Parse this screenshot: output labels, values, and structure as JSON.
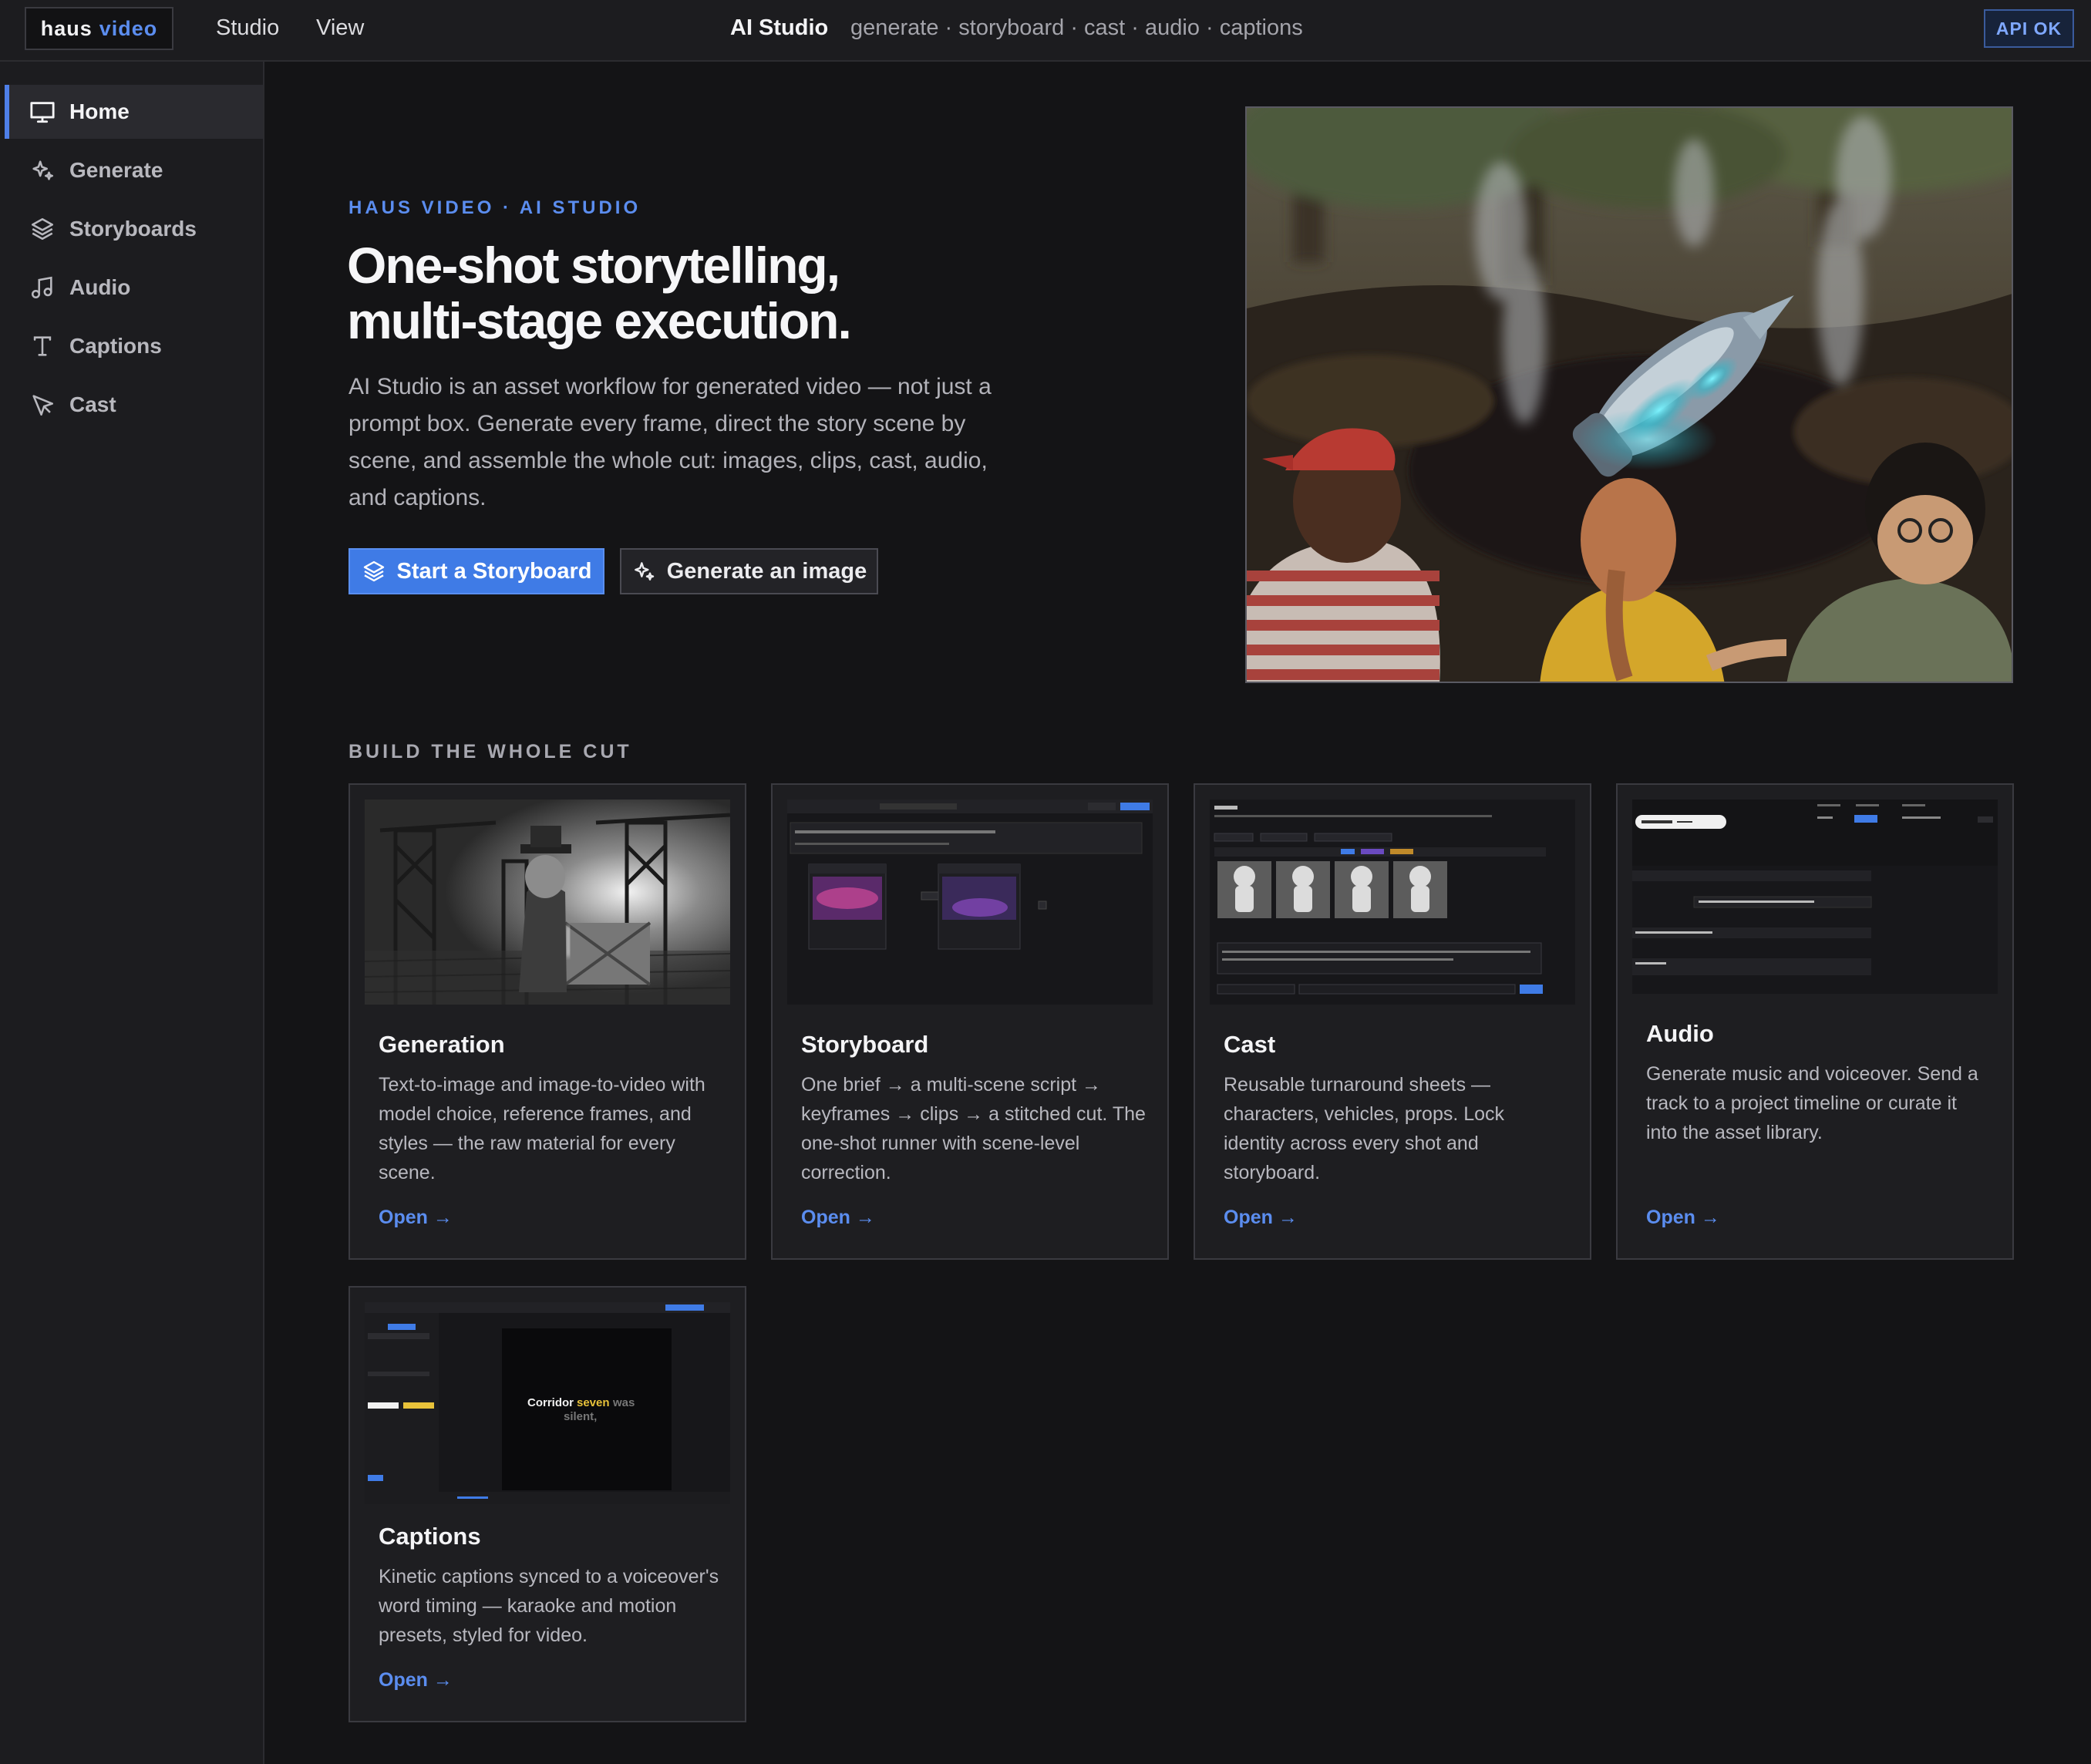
{
  "brand": {
    "name_part1": "haus",
    "name_part2": "video"
  },
  "topbar": {
    "menu": [
      "Studio",
      "View"
    ],
    "title": "AI Studio",
    "subtitle": "generate · storyboard · cast · audio · captions",
    "status_badge": "API OK"
  },
  "sidebar": {
    "items": [
      {
        "label": "Home",
        "icon": "monitor-icon",
        "active": true
      },
      {
        "label": "Generate",
        "icon": "sparkles-icon"
      },
      {
        "label": "Storyboards",
        "icon": "layers-icon"
      },
      {
        "label": "Audio",
        "icon": "music-note-icon"
      },
      {
        "label": "Captions",
        "icon": "text-icon"
      },
      {
        "label": "Cast",
        "icon": "cursor-icon"
      }
    ]
  },
  "hero": {
    "eyebrow": "HAUS VIDEO · AI STUDIO",
    "title_line1": "One-shot storytelling,",
    "title_line2": "multi-stage execution.",
    "description": "AI Studio is an asset workflow for generated video — not just a prompt box. Generate every frame, direct the story scene by scene, and assemble the whole cut: images, clips, cast, audio, and captions.",
    "primary_button": "Start a Storyboard",
    "secondary_button": "Generate an image"
  },
  "section_label": "BUILD THE WHOLE CUT",
  "cards": [
    {
      "title": "Generation",
      "description": "Text-to-image and image-to-video with model choice, reference frames, and styles — the raw material for every scene.",
      "link": "Open →"
    },
    {
      "title": "Storyboard",
      "description": "One brief → a multi-scene script → keyframes → clips → a stitched cut. The one-shot runner with scene-level correction.",
      "link": "Open →"
    },
    {
      "title": "Cast",
      "description": "Reusable turnaround sheets — characters, vehicles, props. Lock identity across every shot and storyboard.",
      "link": "Open →"
    },
    {
      "title": "Audio",
      "description": "Generate music and voiceover. Send a track to a project timeline or curate it into the asset library.",
      "link": "Open →"
    },
    {
      "title": "Captions",
      "description": "Kinetic captions synced to a voiceover's word timing — karaoke and motion presets, styled for video.",
      "link": "Open →"
    }
  ],
  "thumbnails": {
    "captions_preview": {
      "word1": "Corridor",
      "word2": "seven",
      "word3": "was",
      "word4": "silent,"
    }
  },
  "colors": {
    "accent": "#3f7be6",
    "link": "#5b8def",
    "background": "#141416",
    "panel": "#1c1c1f"
  }
}
